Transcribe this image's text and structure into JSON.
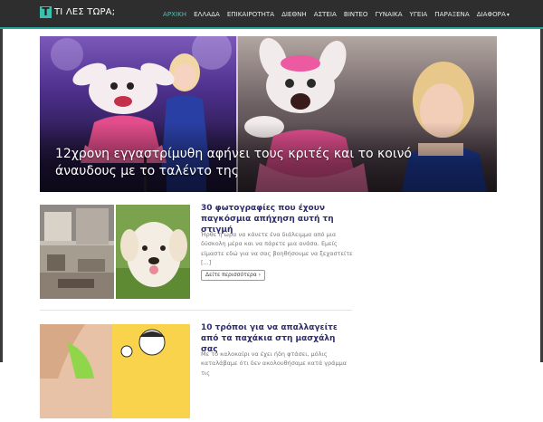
{
  "header": {
    "logo_mark": "T",
    "site_name": "ΤΙ ΛΕΣ ΤΩΡΑ;",
    "nav": [
      {
        "label": "ΑΡΧΙΚΗ",
        "active": true
      },
      {
        "label": "ΕΛΛΑΔΑ"
      },
      {
        "label": "ΕΠΙΚΑΙΡΟΤΗΤΑ"
      },
      {
        "label": "ΔΙΕΘΝΗ"
      },
      {
        "label": "ΑΣΤΕΙΑ"
      },
      {
        "label": "ΒΙΝΤΕΟ"
      },
      {
        "label": "ΓΥΝΑΙΚΑ"
      },
      {
        "label": "ΥΓΕΙΑ"
      },
      {
        "label": "ΠΑΡΑΞΕΝΑ"
      },
      {
        "label": "ΔΙΑΦΟΡΑ"
      }
    ],
    "accent_color": "#3cc9b7",
    "bar_color": "#2e2e2e"
  },
  "featured": {
    "title": "12χρονη εγγαστρίμυθη αφήνει τους κριτές και το κοινό άναυδους με το ταλέντο της"
  },
  "articles": [
    {
      "title": "30 φωτογραφίες που έχουν παγκόσμια απήχηση αυτή τη στιγμή",
      "excerpt": "Ήρθε η ώρα να κάνετε ένα διάλειμμα από μια δύσκολη μέρα και να πάρετε μια ανάσα. Εμείς είμαστε εδώ για να σας βοηθήσουμε να ξεχαστείτε [...]",
      "more_label": "Δείτε περισσότερα ›"
    },
    {
      "title": "10 τρόποι για να απαλλαγείτε από τα παχάκια στη μασχάλη σας",
      "excerpt": "Με το καλοκαίρι να έχει ήδη φτάσει, μόλις καταλάβαμε ότι δεν ακολουθήσαμε κατά γράμμα τις"
    }
  ]
}
